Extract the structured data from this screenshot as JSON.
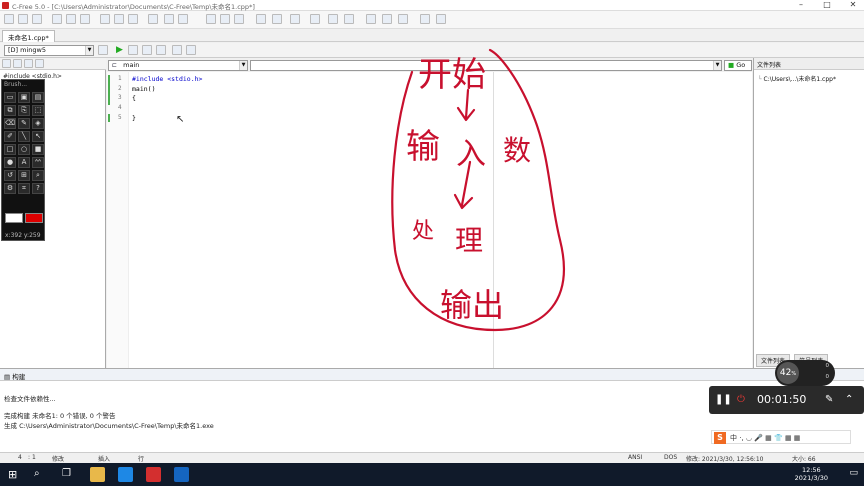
{
  "window": {
    "title": "C-Free 5.0 - [C:\\Users\\Administrator\\Documents\\C-Free\\Temp\\未命名1.cpp*]"
  },
  "editor_tab": {
    "label": "未命名1.cpp*"
  },
  "toolbar2": {
    "compiler": "[D] mingw5",
    "function_combo": "main",
    "go_label": "Go"
  },
  "left_panel": {
    "include_item": "#include <stdio.h>",
    "brush": {
      "title": "Brush...",
      "coord": "x:392  y:259"
    }
  },
  "code_lines": [
    {
      "num": "1",
      "text": "#include <stdio.h>"
    },
    {
      "num": "2",
      "text": "main()"
    },
    {
      "num": "3",
      "text": "{"
    },
    {
      "num": "4",
      "text": ""
    },
    {
      "num": "5",
      "text": "}"
    }
  ],
  "right_panel": {
    "title": "文件列表",
    "file_item": "C:\\Users\\...\\未命名1.cpp*",
    "tabs": [
      "文件列表",
      "符号列表"
    ]
  },
  "build_panel": {
    "title": "构建",
    "lines": [
      "检查文件依赖性...",
      "完成构建 未命名1: 0 个错误, 0 个警告",
      "生成 C:\\Users\\Administrator\\Documents\\C-Free\\Temp\\未命名1.exe"
    ]
  },
  "status_bar": {
    "line": "4",
    "col": "1",
    "modified": "修改",
    "insert": "插入",
    "row": "行",
    "encoding": "ANSI",
    "format": "DOS",
    "modified_time": "修改: 2021/3/30, 12:56:10",
    "size": "大小: 66"
  },
  "recorder": {
    "timer": "00:01:50"
  },
  "gauge": {
    "percent": "42",
    "up": "0",
    "down": "0"
  },
  "ime": {
    "logo": "S",
    "text": "中 ·, ◡ 🎤 ▦ 👕 ▦ ▦"
  },
  "taskbar": {
    "time": "12:56",
    "date": "2021/3/30"
  },
  "handwriting": {
    "top": "开始",
    "input_left": "输",
    "input_mid": "入",
    "input_right": "数",
    "process_left": "处",
    "process_mid": "理",
    "output": "输出"
  },
  "colors": {
    "ink": "#c8102e",
    "brand_red": "#c22",
    "taskbar": "#101a2a"
  }
}
